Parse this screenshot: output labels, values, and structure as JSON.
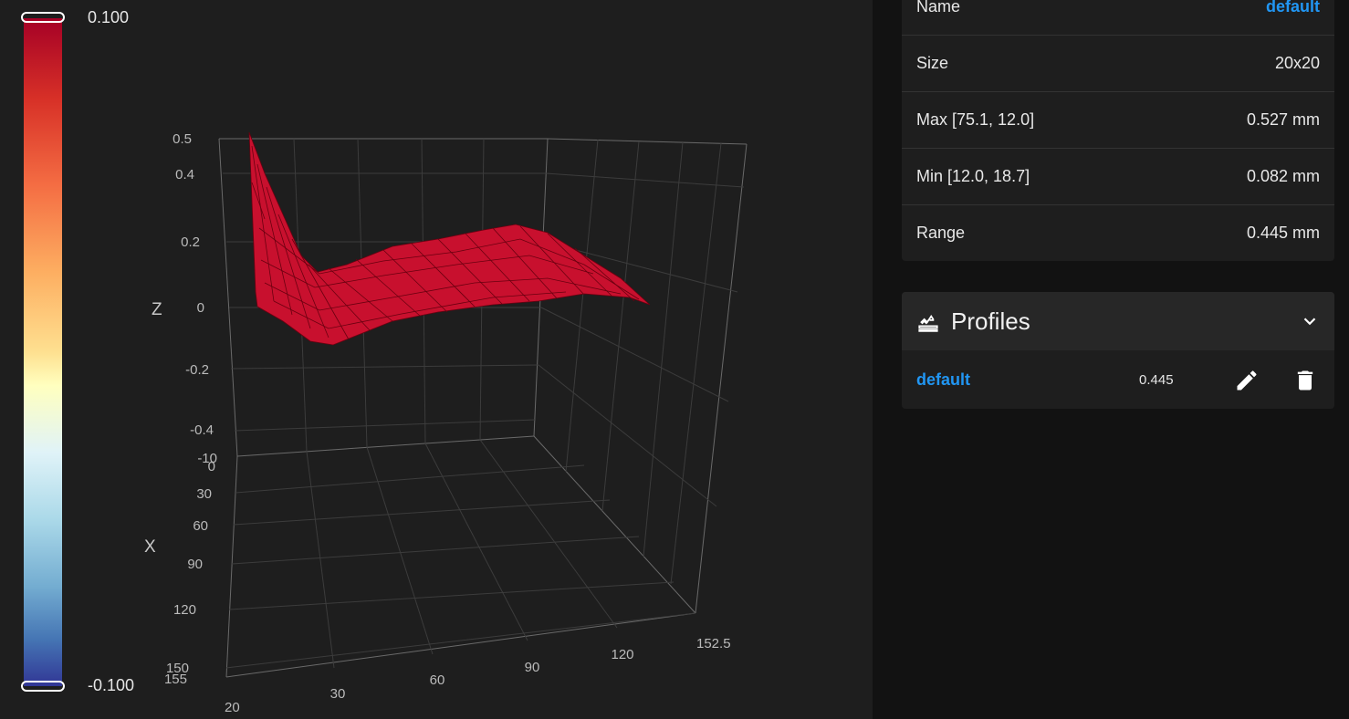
{
  "colorbar": {
    "max_label": "0.100",
    "min_label": "-0.100"
  },
  "plot": {
    "z_axis_title": "Z",
    "x_axis_title": "X",
    "z_ticks": [
      "0.5",
      "0.4",
      "0.2",
      "0",
      "-0.2",
      "-0.4"
    ],
    "x_ticks": [
      "-10",
      "0",
      "30",
      "60",
      "90",
      "120",
      "150",
      "155"
    ],
    "y_ticks": [
      "30",
      "60",
      "90",
      "120",
      "152.5"
    ],
    "extra_tick": "20"
  },
  "mesh_info": {
    "rows": [
      {
        "label": "Name",
        "value": "default"
      },
      {
        "label": "Size",
        "value": "20x20"
      },
      {
        "label": "Max [75.1, 12.0]",
        "value": "0.527 mm"
      },
      {
        "label": "Min [12.0, 18.7]",
        "value": "0.082 mm"
      },
      {
        "label": "Range",
        "value": "0.445 mm"
      }
    ]
  },
  "profiles": {
    "title": "Profiles",
    "icon": "layers-stack-icon",
    "items": [
      {
        "name": "default",
        "range": "0.445"
      }
    ]
  },
  "colors": {
    "surface": "#c8102e",
    "accent": "#2196f3"
  }
}
